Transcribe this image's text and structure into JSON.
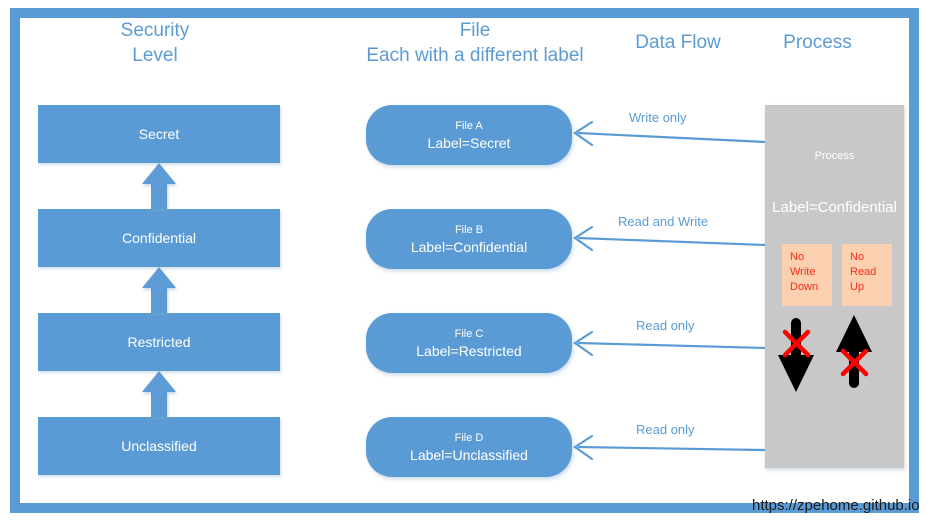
{
  "diagram": {
    "watermark": "https://zpehome.github.io",
    "columns": [
      {
        "title": "Security\nLevel"
      },
      {
        "title": "File\nEach with a different label"
      },
      {
        "title": "Data Flow"
      },
      {
        "title": "Process"
      }
    ],
    "security_levels": [
      {
        "label": "Secret"
      },
      {
        "label": "Confidential"
      },
      {
        "label": "Restricted"
      },
      {
        "label": "Unclassified"
      }
    ],
    "files": [
      {
        "name": "File A",
        "label": "Label=Secret"
      },
      {
        "name": "File B",
        "label": "Label=Confidential"
      },
      {
        "name": "File C",
        "label": "Label=Restricted"
      },
      {
        "name": "File D",
        "label": "Label=Unclassified"
      }
    ],
    "data_flows": [
      {
        "label": "Write only"
      },
      {
        "label": "Read and Write"
      },
      {
        "label": "Read only"
      },
      {
        "label": "Read only"
      }
    ],
    "process": {
      "title": "Process",
      "label": "Label=Confidential",
      "rules": [
        {
          "text": "No\nWrite\nDown"
        },
        {
          "text": "No\nRead\nUp"
        }
      ]
    },
    "colors": {
      "accent_blue": "#5B9BD5",
      "process_gray": "#C8C8C8",
      "rule_peach": "#FAD0B0",
      "rule_red": "#FF2B16",
      "arrow_black": "#000000",
      "cross_red": "#FF0000"
    }
  }
}
